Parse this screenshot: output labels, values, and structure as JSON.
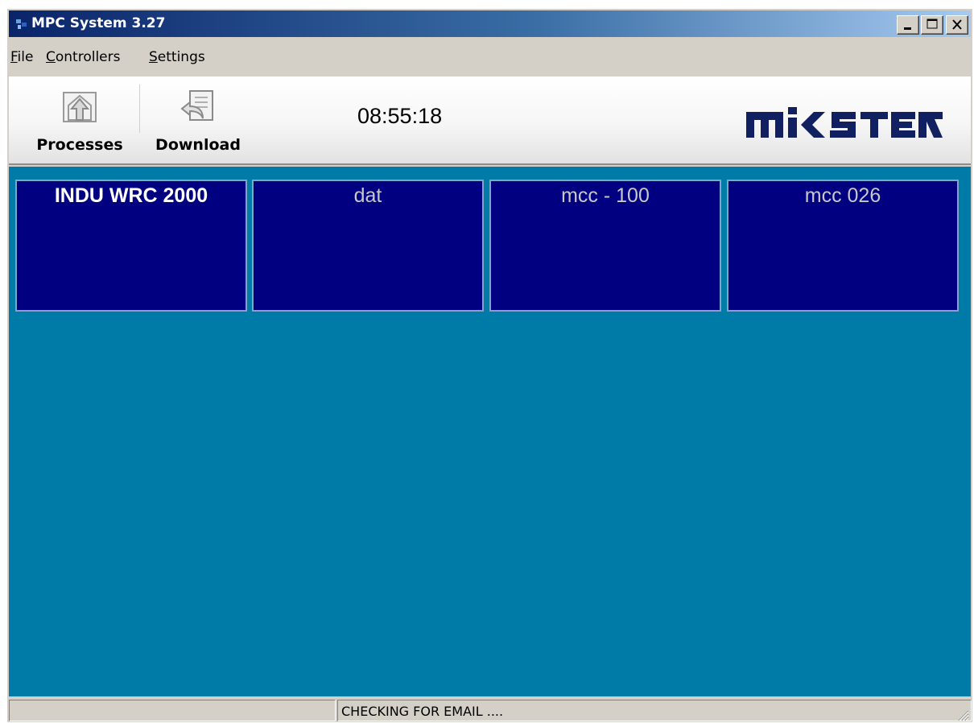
{
  "window": {
    "title": "MPC System 3.27",
    "buttons": {
      "minimize": "minimize-icon",
      "maximize": "maximize-icon",
      "close": "close-icon"
    }
  },
  "menu": {
    "items": [
      {
        "label": "File",
        "accel": "F",
        "rest": "ile"
      },
      {
        "label": "Controllers",
        "accel": "C",
        "rest": "ontrollers"
      },
      {
        "label": "Settings",
        "accel": "S",
        "rest": "ettings"
      }
    ]
  },
  "toolbar": {
    "processes_label": "Processes",
    "processes_icon": "processes-icon",
    "download_label": "Download",
    "download_icon": "download-icon",
    "clock": "08:55:18",
    "logo": "MIKSTER"
  },
  "controllers": [
    {
      "name": "INDU WRC 2000",
      "selected": true
    },
    {
      "name": "dat",
      "selected": false
    },
    {
      "name": "mcc - 100",
      "selected": false
    },
    {
      "name": "mcc 026",
      "selected": false
    }
  ],
  "status": {
    "left": "",
    "message": "CHECKING FOR EMAIL  ...."
  },
  "colors": {
    "titlebar_start": "#0a246a",
    "titlebar_end": "#a6caf0",
    "workspace": "#007ba8",
    "tile": "#000080",
    "logo": "#102060"
  }
}
